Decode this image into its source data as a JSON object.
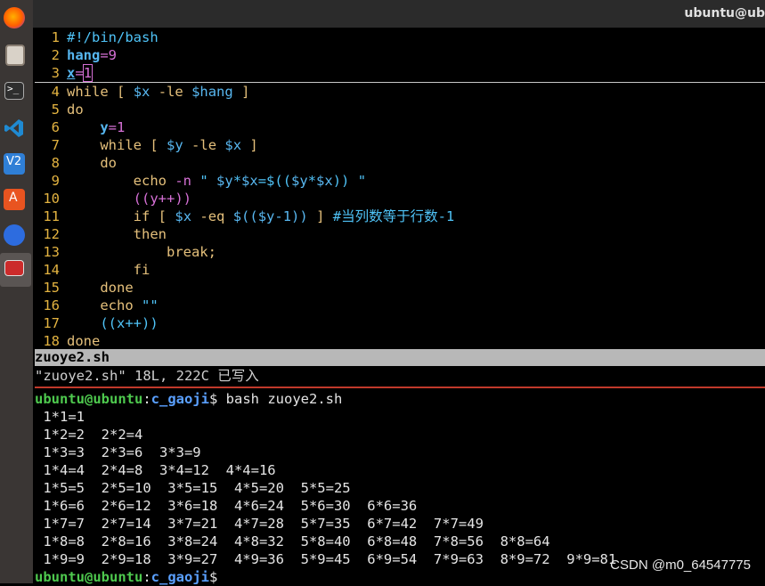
{
  "window": {
    "title": "ubuntu@ub"
  },
  "dock": {
    "items": [
      {
        "icon": "firefox-icon",
        "color": "#e66000"
      },
      {
        "icon": "files-icon",
        "color": "#c96e3b"
      },
      {
        "icon": "terminal-icon",
        "color": "#2e2e2e"
      },
      {
        "icon": "vscode-icon",
        "color": "#1f8ad2"
      },
      {
        "icon": "virtualbox-icon",
        "color": "#2f7fd6"
      },
      {
        "icon": "software-center-icon",
        "color": "#e95420"
      },
      {
        "icon": "settings-icon",
        "color": "#2d6cdf"
      },
      {
        "icon": "terminal-active-icon",
        "color": "#cc2b2b"
      }
    ]
  },
  "editor": {
    "lines": [
      {
        "n": "1",
        "t": "#!/bin/bash"
      },
      {
        "n": "2",
        "t": "hang=9"
      },
      {
        "n": "3",
        "t": "x=1"
      },
      {
        "n": "4",
        "t": "while [ $x -le $hang ]"
      },
      {
        "n": "5",
        "t": "do"
      },
      {
        "n": "6",
        "t": "    y=1"
      },
      {
        "n": "7",
        "t": "    while [ $y -le $x ]"
      },
      {
        "n": "8",
        "t": "    do"
      },
      {
        "n": "9",
        "t": "        echo -n \" $y*$x=$(($y*$x)) \""
      },
      {
        "n": "10",
        "t": "        ((y++))"
      },
      {
        "n": "11",
        "t": "        if [ $x -eq $(($y-1)) ] #当列数等于行数-1"
      },
      {
        "n": "12",
        "t": "        then"
      },
      {
        "n": "13",
        "t": "            break;"
      },
      {
        "n": "14",
        "t": "        fi"
      },
      {
        "n": "15",
        "t": "    done"
      },
      {
        "n": "16",
        "t": "    echo \"\""
      },
      {
        "n": "17",
        "t": "    ((x++))"
      },
      {
        "n": "18",
        "t": "done"
      }
    ],
    "status_filename": "zuoye2.sh",
    "message": "\"zuoye2.sh\" 18L, 222C 已写入"
  },
  "terminal": {
    "prompt_user": "ubuntu@ubuntu",
    "prompt_sep": ":",
    "prompt_path": "c_gaoji",
    "prompt_end": "$",
    "command": " bash zuoye2.sh",
    "output": [
      " 1*1=1",
      " 1*2=2  2*2=4",
      " 1*3=3  2*3=6  3*3=9",
      " 1*4=4  2*4=8  3*4=12  4*4=16",
      " 1*5=5  2*5=10  3*5=15  4*5=20  5*5=25",
      " 1*6=6  2*6=12  3*6=18  4*6=24  5*6=30  6*6=36",
      " 1*7=7  2*7=14  3*7=21  4*7=28  5*7=35  6*7=42  7*7=49",
      " 1*8=8  2*8=16  3*8=24  4*8=32  5*8=40  6*8=48  7*8=56  8*8=64",
      " 1*9=9  2*9=18  3*9=27  4*9=36  5*9=45  6*9=54  7*9=63  8*9=72  9*9=81"
    ]
  },
  "watermark": "CSDN @m0_64547775"
}
